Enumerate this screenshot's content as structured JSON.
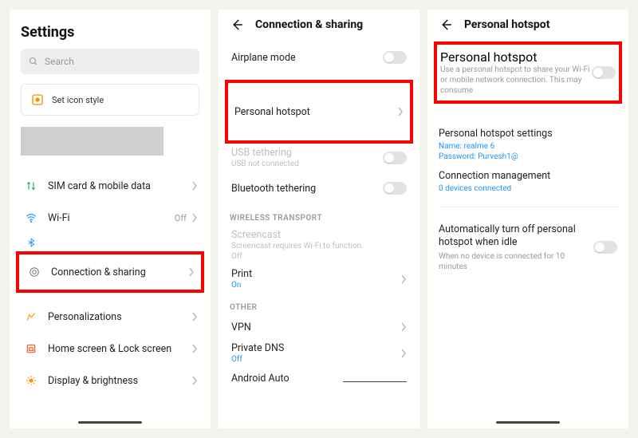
{
  "panel1": {
    "title": "Settings",
    "search_placeholder": "Search",
    "icon_style": "Set icon style",
    "items": {
      "sim": "SIM card & mobile data",
      "wifi": "Wi-Fi",
      "wifi_val": "Off",
      "bluetooth": "Bluetooth",
      "connection": "Connection & sharing",
      "personal": "Personalizations",
      "home": "Home screen & Lock screen",
      "display": "Display & brightness"
    }
  },
  "panel2": {
    "title": "Connection & sharing",
    "airplane": "Airplane mode",
    "hotspot": "Personal hotspot",
    "usb": "USB tethering",
    "usb_sub": "USB not connected",
    "bt": "Bluetooth tethering",
    "section_wireless": "WIRELESS TRANSPORT",
    "screencast": "Screencast",
    "screencast_sub": "Screencast requires Wi-Fi to function.",
    "screencast_val": "Off",
    "print": "Print",
    "print_val": "On",
    "section_other": "OTHER",
    "vpn": "VPN",
    "pdns": "Private DNS",
    "pdns_val": "Off",
    "aauto": "Android Auto"
  },
  "panel3": {
    "title": "Personal hotspot",
    "hotspot_title": "Personal hotspot",
    "hotspot_sub": "Use a personal hotspot to share your Wi-Fi or mobile network connection. This may consume",
    "settings_title": "Personal hotspot settings",
    "settings_name": "Name: realme 6",
    "settings_pass": "Password: Purvesh1@",
    "conn_title": "Connection management",
    "conn_sub": "0 devices connected",
    "auto_title": "Automatically turn off personal hotspot when idle",
    "auto_sub": "When no device is connected for 10 minutes"
  }
}
